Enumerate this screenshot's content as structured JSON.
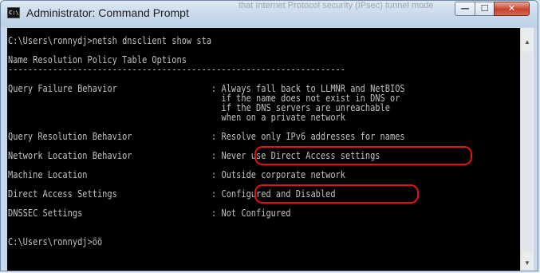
{
  "window": {
    "title": "Administrator: Command Prompt",
    "icon_label": "C:\\",
    "background_text": "that Internet Protocol security (IPsec) tunnel mode"
  },
  "controls": {
    "minimize": "—",
    "maximize": "☐",
    "close": "✕"
  },
  "console": {
    "lines": [
      "C:\\Users\\ronnydj>netsh dnsclient show sta",
      "",
      "Name Resolution Policy Table Options",
      "--------------------------------------------------------------------",
      "",
      "Query Failure Behavior                   : Always fall back to LLMNR and NetBIOS",
      "                                           if the name does not exist in DNS or",
      "                                           if the DNS servers are unreachable",
      "                                           when on a private network",
      "",
      "Query Resolution Behavior                : Resolve only IPv6 addresses for names",
      "",
      "Network Location Behavior                : Never use Direct Access settings",
      "",
      "Machine Location                         : Outside corporate network",
      "",
      "Direct Access Settings                   : Configured and Disabled",
      "",
      "DNSSEC Settings                          : Not Configured",
      "",
      "",
      "C:\\Users\\ronnydj>öö"
    ]
  },
  "scrollbar": {
    "up_arrow": "▲",
    "down_arrow": "▼"
  },
  "colors": {
    "console_bg": "#000000",
    "console_text": "#c0c0c0",
    "annotation": "#e01414"
  }
}
